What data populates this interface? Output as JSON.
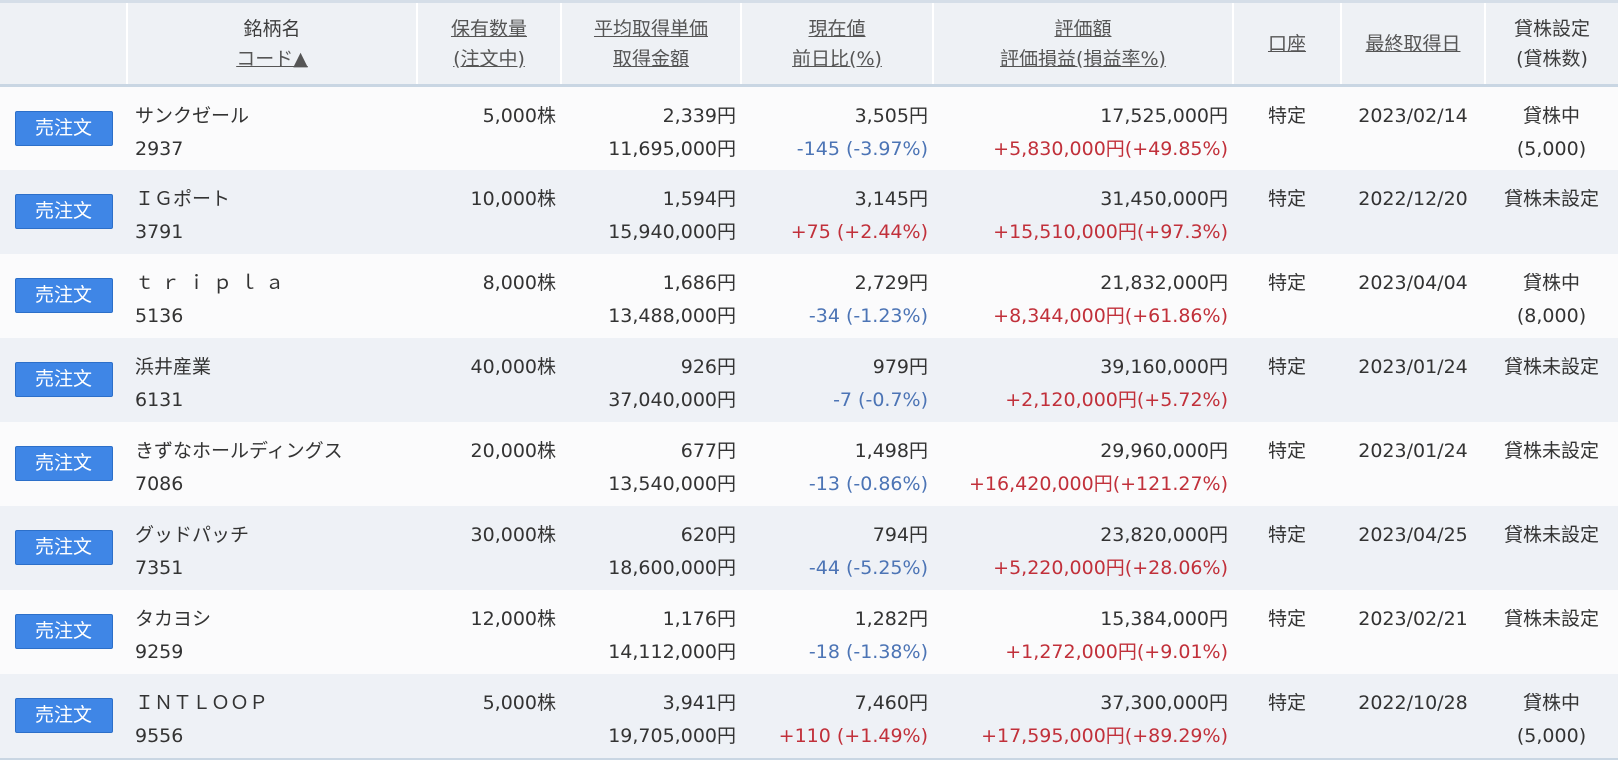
{
  "headers": {
    "name_l1": "銘柄名",
    "name_l2": "コード▲",
    "qty_l1": "保有数量",
    "qty_l2": "(注文中)",
    "avg_l1": "平均取得単価",
    "avg_l2": "取得金額",
    "price_l1": "現在値",
    "price_l2": "前日比(%)",
    "val_l1": "評価額",
    "val_l2": "評価損益(損益率%)",
    "account": "口座",
    "date": "最終取得日",
    "lend_l1": "貸株設定",
    "lend_l2": "(貸株数)"
  },
  "sell_label": "売注文",
  "colors": {
    "positive": "#c1303a",
    "negative": "#4c74b5",
    "button": "#3f86e6"
  },
  "rows": [
    {
      "name": "サンクゼール",
      "code": "2937",
      "qty": "5,000株",
      "avg": "2,339円",
      "cost": "11,695,000円",
      "price": "3,505円",
      "change": "-145 (-3.97%)",
      "change_sign": "neg",
      "value": "17,525,000円",
      "pl_amount": "+5,830,000円",
      "pl_rate": "(+49.85%)",
      "account": "特定",
      "date": "2023/02/14",
      "lend": "貸株中",
      "lend_count": "(5,000)"
    },
    {
      "name": "ＩＧポート",
      "code": "3791",
      "qty": "10,000株",
      "avg": "1,594円",
      "cost": "15,940,000円",
      "price": "3,145円",
      "change": "+75 (+2.44%)",
      "change_sign": "pos",
      "value": "31,450,000円",
      "pl_amount": "+15,510,000円",
      "pl_rate": "(+97.3%)",
      "account": "特定",
      "date": "2022/12/20",
      "lend": "貸株未設定",
      "lend_count": ""
    },
    {
      "name": "ｔｒｉｐｌａ",
      "code": "5136",
      "qty": "8,000株",
      "avg": "1,686円",
      "cost": "13,488,000円",
      "price": "2,729円",
      "change": "-34 (-1.23%)",
      "change_sign": "neg",
      "value": "21,832,000円",
      "pl_amount": "+8,344,000円",
      "pl_rate": "(+61.86%)",
      "account": "特定",
      "date": "2023/04/04",
      "lend": "貸株中",
      "lend_count": "(8,000)"
    },
    {
      "name": "浜井産業",
      "code": "6131",
      "qty": "40,000株",
      "avg": "926円",
      "cost": "37,040,000円",
      "price": "979円",
      "change": "-7 (-0.7%)",
      "change_sign": "neg",
      "value": "39,160,000円",
      "pl_amount": "+2,120,000円",
      "pl_rate": "(+5.72%)",
      "account": "特定",
      "date": "2023/01/24",
      "lend": "貸株未設定",
      "lend_count": ""
    },
    {
      "name": "きずなホールディングス",
      "code": "7086",
      "qty": "20,000株",
      "avg": "677円",
      "cost": "13,540,000円",
      "price": "1,498円",
      "change": "-13 (-0.86%)",
      "change_sign": "neg",
      "value": "29,960,000円",
      "pl_amount": "+16,420,000円",
      "pl_rate": "(+121.27%)",
      "account": "特定",
      "date": "2023/01/24",
      "lend": "貸株未設定",
      "lend_count": ""
    },
    {
      "name": "グッドパッチ",
      "code": "7351",
      "qty": "30,000株",
      "avg": "620円",
      "cost": "18,600,000円",
      "price": "794円",
      "change": "-44 (-5.25%)",
      "change_sign": "neg",
      "value": "23,820,000円",
      "pl_amount": "+5,220,000円",
      "pl_rate": "(+28.06%)",
      "account": "特定",
      "date": "2023/04/25",
      "lend": "貸株未設定",
      "lend_count": ""
    },
    {
      "name": "タカヨシ",
      "code": "9259",
      "qty": "12,000株",
      "avg": "1,176円",
      "cost": "14,112,000円",
      "price": "1,282円",
      "change": "-18 (-1.38%)",
      "change_sign": "neg",
      "value": "15,384,000円",
      "pl_amount": "+1,272,000円",
      "pl_rate": "(+9.01%)",
      "account": "特定",
      "date": "2023/02/21",
      "lend": "貸株未設定",
      "lend_count": ""
    },
    {
      "name": "ＩＮＴＬＯＯＰ",
      "code": "9556",
      "qty": "5,000株",
      "avg": "3,941円",
      "cost": "19,705,000円",
      "price": "7,460円",
      "change": "+110 (+1.49%)",
      "change_sign": "pos",
      "value": "37,300,000円",
      "pl_amount": "+17,595,000円",
      "pl_rate": "(+89.29%)",
      "account": "特定",
      "date": "2022/10/28",
      "lend": "貸株中",
      "lend_count": "(5,000)"
    }
  ]
}
